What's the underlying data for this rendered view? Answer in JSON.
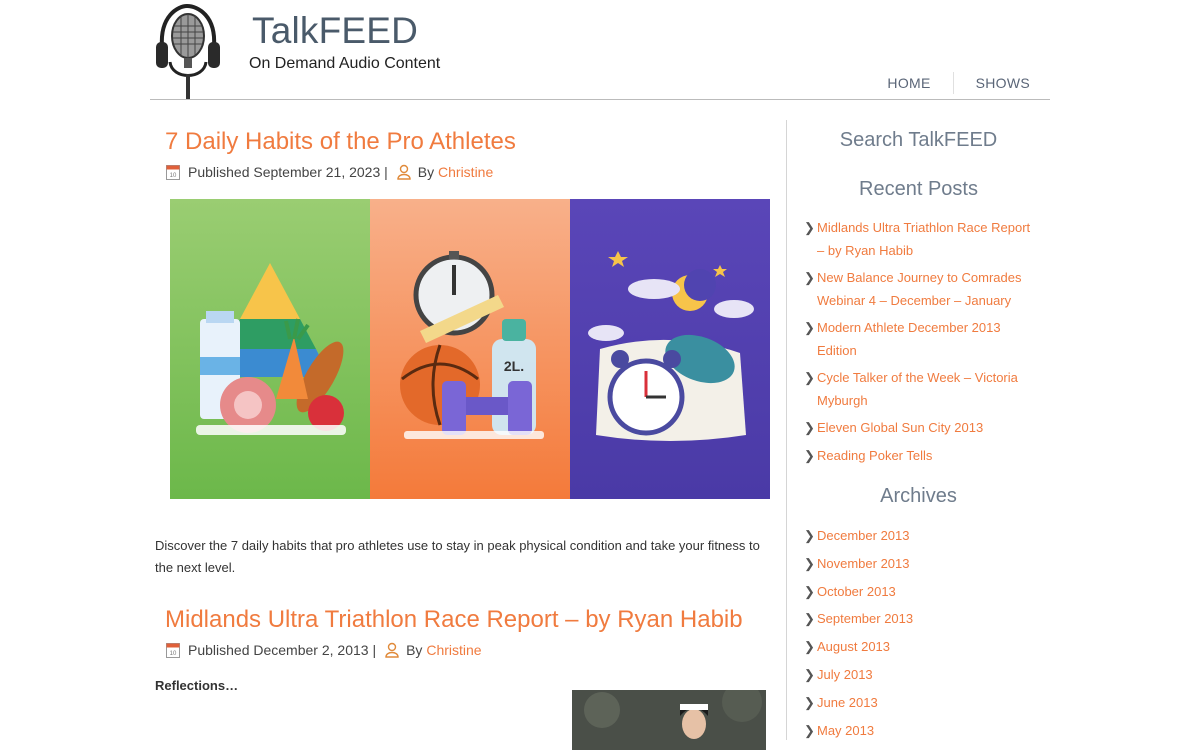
{
  "site": {
    "title": "TalkFEED",
    "tagline": "On Demand Audio Content"
  },
  "nav": {
    "items": [
      {
        "label": "HOME"
      },
      {
        "label": "SHOWS"
      }
    ]
  },
  "posts": [
    {
      "title": "7 Daily Habits of the Pro Athletes",
      "published": "Published September 21, 2023",
      "by": "By",
      "author": "Christine",
      "excerpt": "Discover the 7 daily habits that pro athletes use to stay in peak physical condition and take your fitness to the next level.",
      "image": {
        "panels": [
          "nutrition",
          "training",
          "sleep"
        ],
        "bottle_label": "2L."
      }
    },
    {
      "title": "Midlands Ultra Triathlon Race Report – by Ryan Habib",
      "published": "Published December 2, 2013",
      "by": "By",
      "author": "Christine",
      "subheading": "Reflections…"
    }
  ],
  "sidebar": {
    "search_title": "Search TalkFEED",
    "recent_title": "Recent Posts",
    "recent": [
      "Midlands Ultra Triathlon Race Report – by Ryan Habib",
      "New Balance Journey to Comrades Webinar 4 – December – January",
      "Modern Athlete December 2013 Edition",
      "Cycle Talker of the Week – Victoria Myburgh",
      "Eleven Global Sun City 2013",
      "Reading Poker Tells"
    ],
    "archives_title": "Archives",
    "archives": [
      "December 2013",
      "November 2013",
      "October 2013",
      "September 2013",
      "August 2013",
      "July 2013",
      "June 2013",
      "May 2013"
    ]
  },
  "colors": {
    "accent": "#f07b3f",
    "title": "#4a5a6a",
    "widget_title": "#6f7c8c"
  },
  "icons": [
    "microphone-headphones-logo",
    "calendar-icon",
    "user-icon",
    "chevron-right-icon"
  ]
}
